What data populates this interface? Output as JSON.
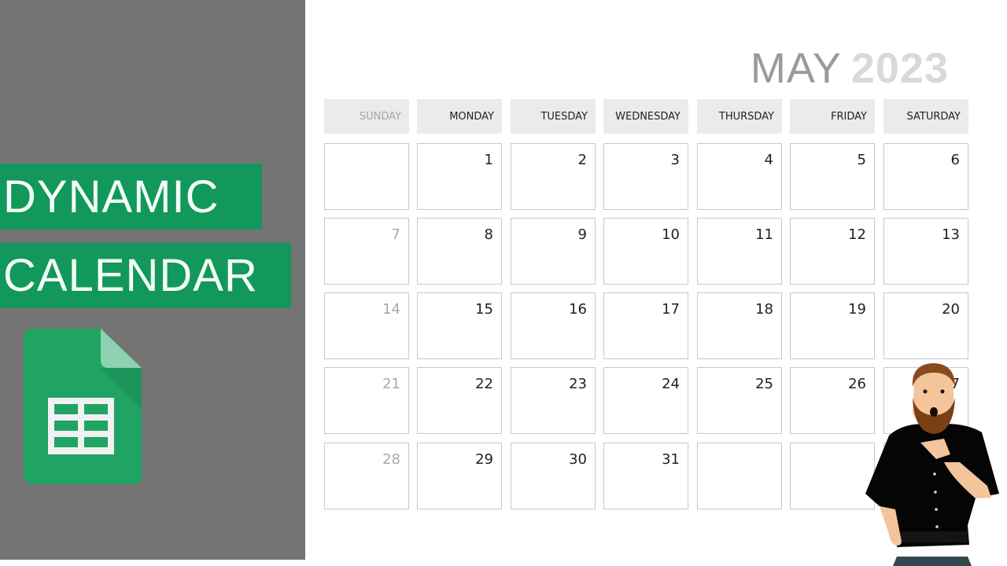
{
  "left_panel": {
    "title_line_1": "DYNAMIC",
    "title_line_2": "CALENDAR",
    "logo_icon": "google-sheets-icon"
  },
  "calendar": {
    "month": "MAY",
    "year": "2023",
    "weekdays": [
      "SUNDAY",
      "MONDAY",
      "TUESDAY",
      "WEDNESDAY",
      "THURSDAY",
      "FRIDAY",
      "SATURDAY"
    ],
    "weeks": [
      [
        "",
        "1",
        "2",
        "3",
        "4",
        "5",
        "6"
      ],
      [
        "7",
        "8",
        "9",
        "10",
        "11",
        "12",
        "13"
      ],
      [
        "14",
        "15",
        "16",
        "17",
        "18",
        "19",
        "20"
      ],
      [
        "21",
        "22",
        "23",
        "24",
        "25",
        "26",
        "27"
      ],
      [
        "28",
        "29",
        "30",
        "31",
        "",
        "",
        ""
      ]
    ]
  },
  "colors": {
    "panel_gray": "#747474",
    "banner_green": "#12985a",
    "header_bg": "#ebebeb",
    "muted_text": "#a8a8a8"
  },
  "presenter": {
    "label": "presenter-illustration"
  }
}
